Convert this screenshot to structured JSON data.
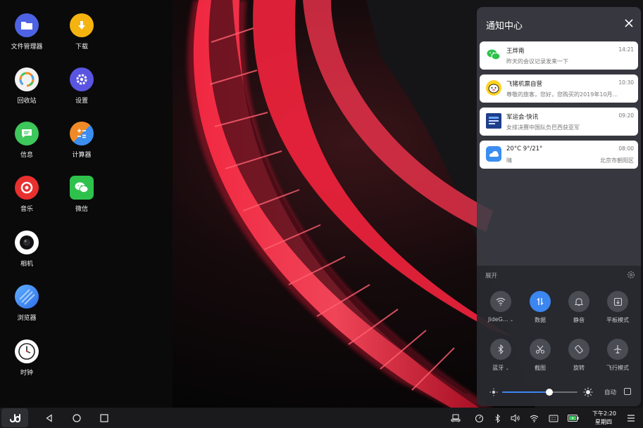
{
  "desktop": {
    "icons": [
      {
        "label": "文件管理器",
        "icon": "folder-icon",
        "color": "#4d63e3"
      },
      {
        "label": "下载",
        "icon": "download-icon",
        "color": "#f5b30f"
      },
      {
        "label": "回收站",
        "icon": "recycle-bin-icon",
        "color": "#f2f2f2"
      },
      {
        "label": "设置",
        "icon": "settings-gear-icon",
        "color": "#5a55e0"
      },
      {
        "label": "信息",
        "icon": "message-icon",
        "color": "#3ec75a"
      },
      {
        "label": "计算器",
        "icon": "calculator-icon",
        "color": "#f08a26"
      },
      {
        "label": "音乐",
        "icon": "music-icon",
        "color": "#e8302f"
      },
      {
        "label": "微信",
        "icon": "wechat-icon",
        "color": "#2ec24c"
      },
      {
        "label": "相机",
        "icon": "camera-icon",
        "color": "#ffffff"
      },
      {
        "label": "浏览器",
        "icon": "browser-icon",
        "color": "#3b8df0"
      },
      {
        "label": "时钟",
        "icon": "clock-icon",
        "color": "#ffffff"
      }
    ]
  },
  "notification_center": {
    "title": "通知中心",
    "notifications": [
      {
        "app_icon": "wechat-icon",
        "title": "王烨南",
        "body": "昨天的会议记录发来一下",
        "time": "14:21",
        "location": ""
      },
      {
        "app_icon": "fliggy-icon",
        "title": "飞猪机票自营",
        "body": "尊敬的旅客，您好，您购买的2019年10月...",
        "time": "10:30",
        "location": ""
      },
      {
        "app_icon": "news-icon",
        "title": "军运会·快讯",
        "body": "女排决赛中国队负巴西获亚军",
        "time": "09:20",
        "location": ""
      },
      {
        "app_icon": "weather-icon",
        "title": "20°C 9°/21°",
        "body": "晴",
        "time": "08:00",
        "location": "北京市朝阳区"
      }
    ]
  },
  "quick_settings": {
    "expand_label": "展开",
    "tiles": [
      {
        "label": "JideG...",
        "icon": "wifi-icon",
        "active": false,
        "has_menu": true
      },
      {
        "label": "数据",
        "icon": "mobile-data-icon",
        "active": true,
        "has_menu": false
      },
      {
        "label": "静音",
        "icon": "bell-icon",
        "active": false,
        "has_menu": false
      },
      {
        "label": "平板模式",
        "icon": "tablet-mode-icon",
        "active": false,
        "has_menu": false
      },
      {
        "label": "蓝牙",
        "icon": "bluetooth-icon",
        "active": false,
        "has_menu": true
      },
      {
        "label": "截图",
        "icon": "scissors-icon",
        "active": false,
        "has_menu": false
      },
      {
        "label": "旋转",
        "icon": "rotate-icon",
        "active": false,
        "has_menu": false
      },
      {
        "label": "飞行模式",
        "icon": "airplane-icon",
        "active": false,
        "has_menu": false
      }
    ],
    "brightness": 0.63,
    "auto_brightness_label": "自动",
    "auto_brightness_checked": false,
    "accent": "#3b86f0"
  },
  "taskbar": {
    "time": "下午2:20",
    "day": "星期四",
    "battery_color": "#38c85a"
  }
}
